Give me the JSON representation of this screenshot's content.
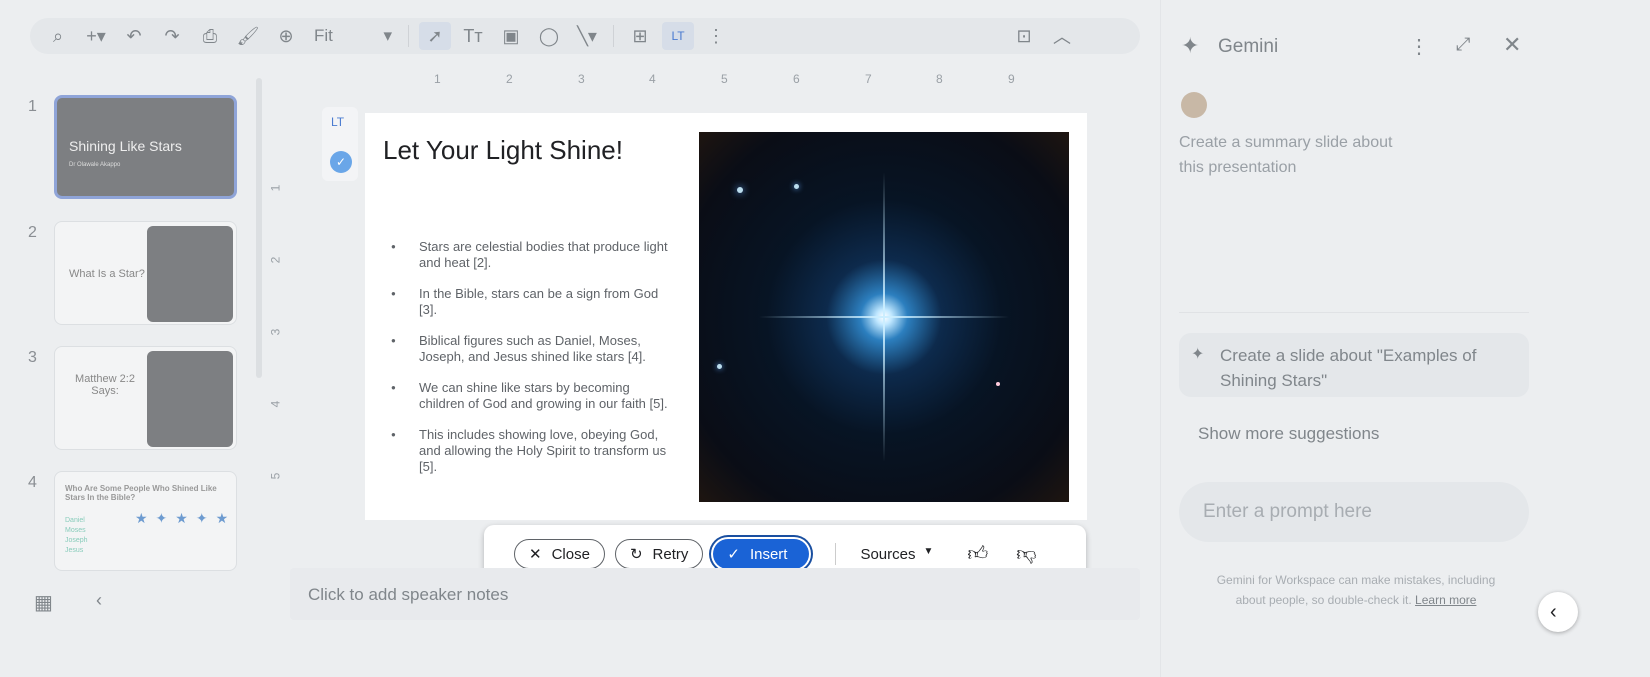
{
  "toolbar": {
    "zoom": "Fit",
    "icons": [
      "search-icon",
      "add-icon",
      "undo-icon",
      "redo-icon",
      "print-icon",
      "paint-format-icon",
      "zoom-icon",
      "select-icon",
      "text-box-icon",
      "image-icon",
      "shape-icon",
      "line-icon",
      "comment-icon",
      "languagetool-icon",
      "more-icon",
      "add-image-icon",
      "collapse-icon"
    ]
  },
  "slides": [
    {
      "num": "1",
      "title": "Shining Like Stars",
      "subtitle": "Dr Olawale Akappo"
    },
    {
      "num": "2",
      "title": "What Is a Star?"
    },
    {
      "num": "3",
      "title": "Matthew 2:2 Says:"
    },
    {
      "num": "4",
      "title": "Who Are Some People Who Shined Like Stars In the Bible?",
      "items": [
        "Daniel",
        "Moses",
        "Joseph",
        "Jesus"
      ]
    }
  ],
  "ruler": {
    "h": [
      "1",
      "2",
      "3",
      "4",
      "5",
      "6",
      "7",
      "8",
      "9"
    ],
    "v": [
      "1",
      "2",
      "3",
      "4",
      "5"
    ]
  },
  "slide": {
    "title": "Let Your Light Shine!",
    "bullets": [
      "Stars are celestial bodies that produce light and heat [2].",
      "In the Bible, stars can be a sign from God [3].",
      "Biblical figures such as Daniel, Moses, Joseph, and Jesus shined like stars [4].",
      "We can shine like stars by becoming children of God and growing in our faith [5].",
      "This includes showing love, obeying God, and allowing the Holy Spirit to transform us [5]."
    ]
  },
  "actions": {
    "close": "Close",
    "retry": "Retry",
    "insert": "Insert",
    "sources": "Sources"
  },
  "notes": "Click to add speaker notes",
  "gemini": {
    "title": "Gemini",
    "user_prompt": "Create a summary slide about this presentation",
    "suggestion": "Create a slide about \"Examples of Shining Stars\"",
    "more": "Show more suggestions",
    "placeholder": "Enter a prompt here",
    "disclaimer": "Gemini for Workspace can make mistakes, including about people, so double-check it.",
    "learn_more": "Learn more"
  },
  "colors": {
    "accent": "#1a63d6",
    "background": "#eceef0"
  }
}
